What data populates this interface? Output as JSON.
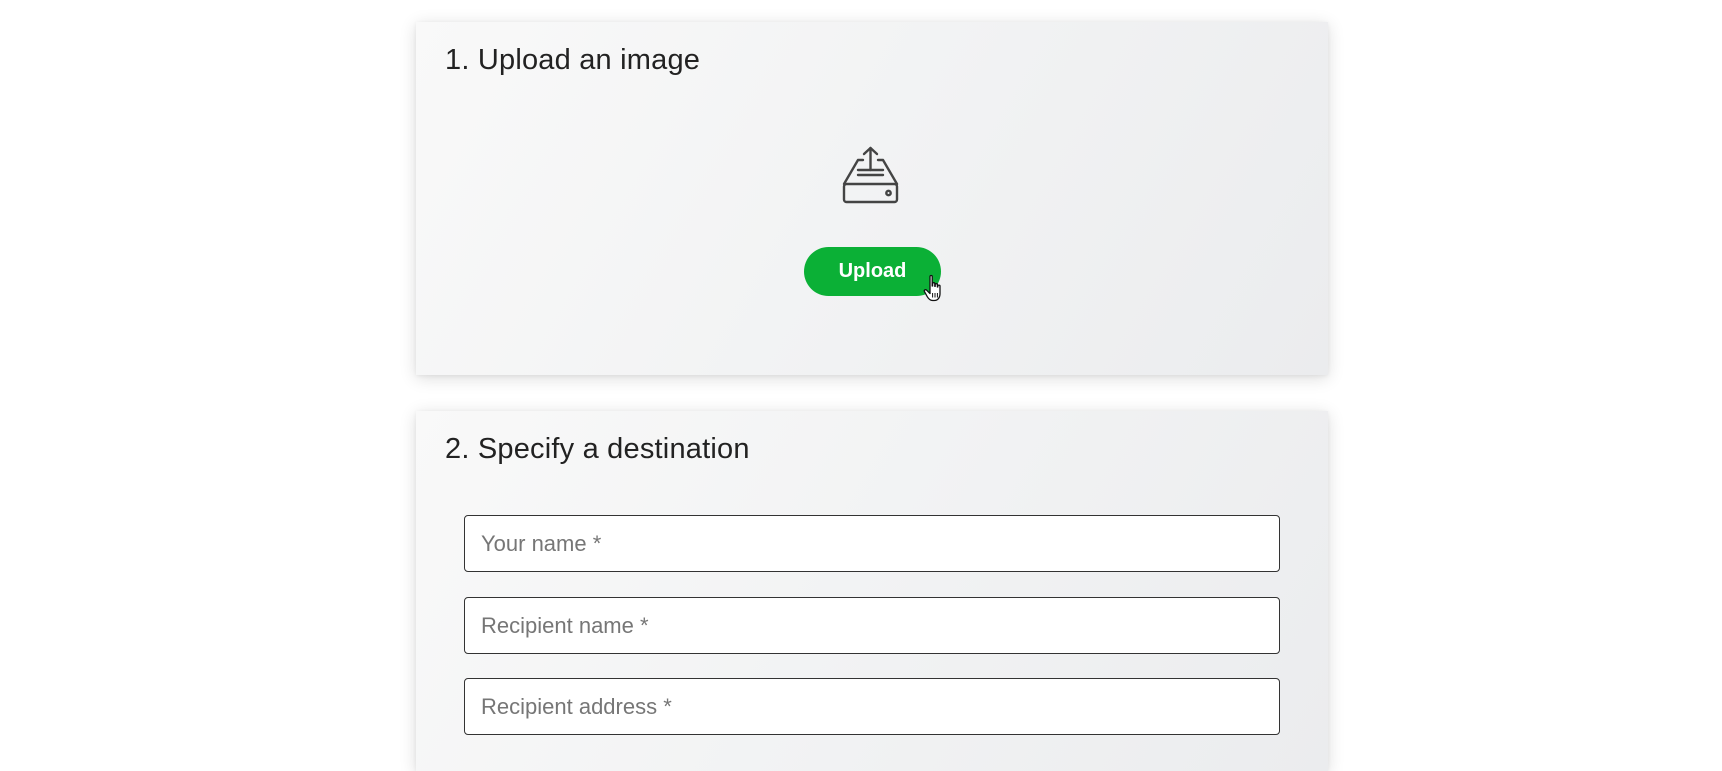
{
  "upload_section": {
    "title": "1. Upload an image",
    "upload_icon": "inbox-tray-upload-icon",
    "upload_button_label": "Upload",
    "button_color": "#0bb036",
    "cursor_icon": "hand-pointer-icon"
  },
  "destination_section": {
    "title": "2. Specify a destination",
    "fields": [
      {
        "placeholder": "Your name *",
        "value": ""
      },
      {
        "placeholder": "Recipient name *",
        "value": ""
      },
      {
        "placeholder": "Recipient address *",
        "value": ""
      }
    ]
  }
}
